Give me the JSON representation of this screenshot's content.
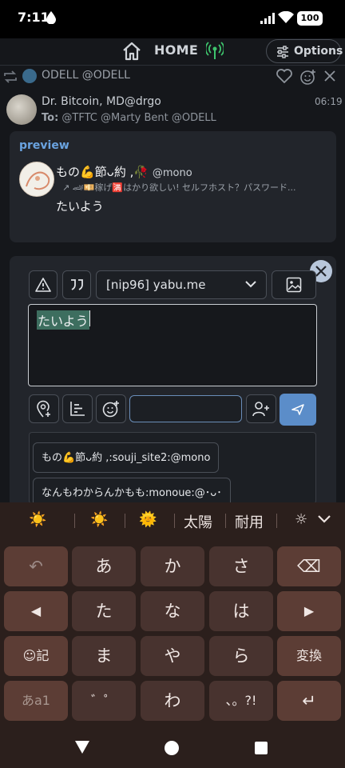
{
  "status": {
    "time": "7:11",
    "battery": "100"
  },
  "topnav": {
    "home_label": "HOME",
    "options_label": "Options"
  },
  "repost": {
    "name": "ODELL",
    "handle": "@ODELL"
  },
  "post": {
    "name": "Dr. Bitcoin, MD",
    "handle": "@drgo",
    "time": "06:19",
    "to_label": "To:",
    "to_list": "@TFTC @Marty Bent @ODELL"
  },
  "preview": {
    "label": "preview",
    "name": "もの💪‍節ᴗ約 ,🥀",
    "handle": "@mono",
    "bio": "↗ 🏎💴稼げ🈵はかり欲しい! セルフホスト？パスワード...",
    "body": "たいよう"
  },
  "composer": {
    "server": "[nip96] yabu.me",
    "text": "たいよう",
    "tag_placeholder": ""
  },
  "suggestions": [
    "もの💪‍節ᴗ約 ,:souji_site2:@mono",
    "なんもわからんかもも:monoue:@･ᴗ･"
  ],
  "ime": {
    "candidates": [
      "☀️",
      "☀️",
      "🌞",
      "太陽",
      "耐用",
      "☼"
    ]
  },
  "keyboard": {
    "row1": [
      "↶",
      "あ",
      "か",
      "さ",
      "⌫"
    ],
    "row2": [
      "◀",
      "た",
      "な",
      "は",
      "▶"
    ],
    "row3": [
      "☺記",
      "ま",
      "や",
      "ら",
      "変換"
    ],
    "row4": [
      "あa1",
      "゛゜",
      "わ",
      "、。?!",
      "↵"
    ]
  }
}
